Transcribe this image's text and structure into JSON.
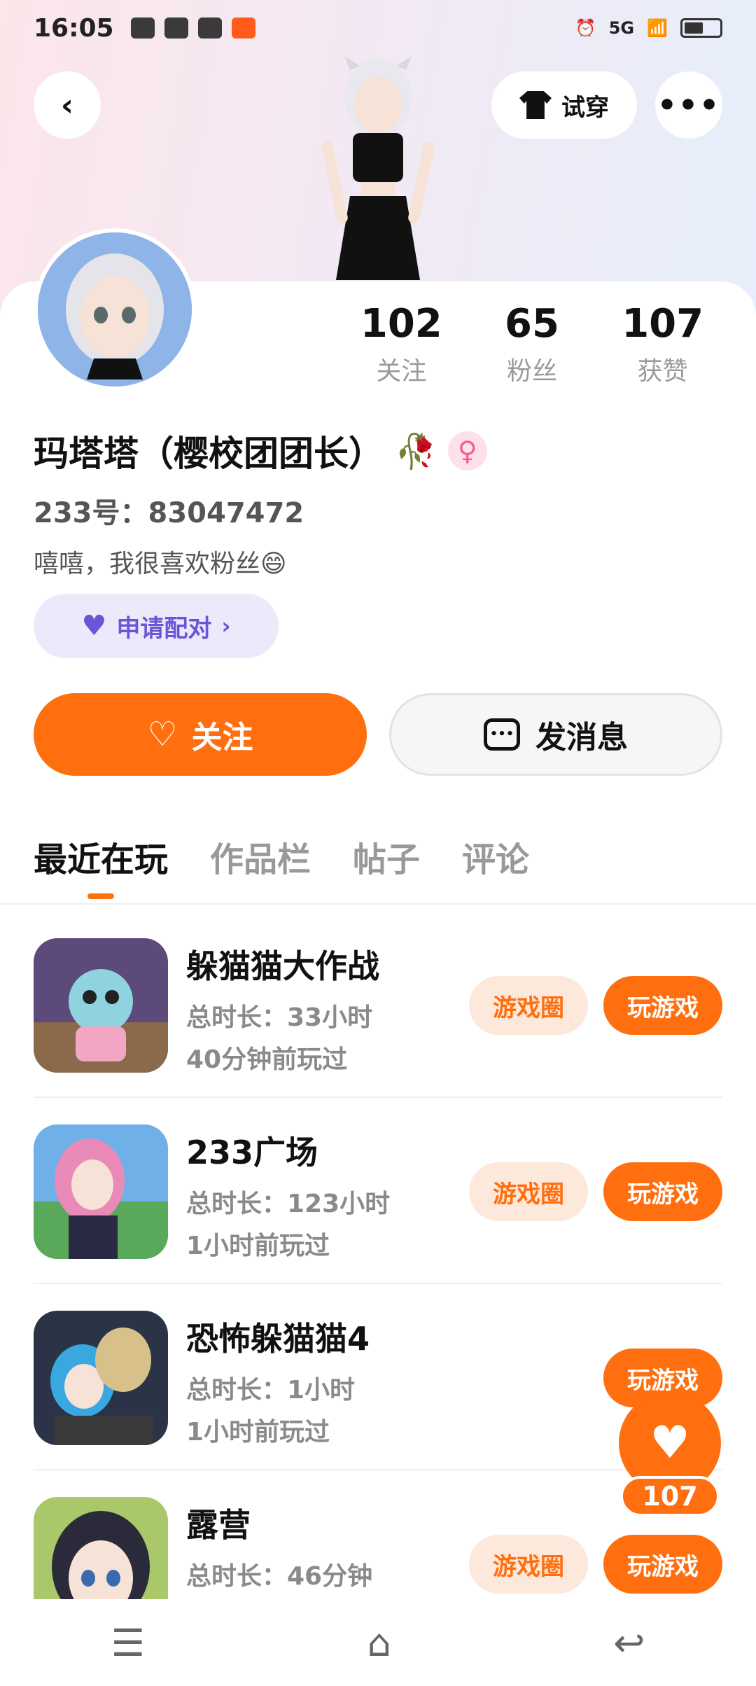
{
  "status_bar": {
    "time": "16:05",
    "network": "5G"
  },
  "header": {
    "try_on_label": "试穿",
    "more_label": "•••"
  },
  "profile": {
    "name": "玛塔塔（樱校团团长）",
    "uid_label": "233号：83047472",
    "bio": "嘻嘻，我很喜欢粉丝😄",
    "stats": [
      {
        "num": "102",
        "label": "关注"
      },
      {
        "num": "65",
        "label": "粉丝"
      },
      {
        "num": "107",
        "label": "获赞"
      }
    ]
  },
  "actions": {
    "pair_label": "申请配对",
    "follow_label": "关注",
    "message_label": "发消息"
  },
  "tabs": [
    "最近在玩",
    "作品栏",
    "帖子",
    "评论"
  ],
  "games": [
    {
      "title": "躲猫猫大作战",
      "total": "总时长：33小时",
      "last": "40分钟前玩过",
      "circle": "游戏圈",
      "play": "玩游戏"
    },
    {
      "title": "233广场",
      "total": "总时长：123小时",
      "last": "1小时前玩过",
      "circle": "游戏圈",
      "play": "玩游戏"
    },
    {
      "title": "恐怖躲猫猫4",
      "total": "总时长：1小时",
      "last": "1小时前玩过",
      "circle": "",
      "play": "玩游戏"
    },
    {
      "title": "露营",
      "total": "总时长：46分钟",
      "last": "",
      "circle": "游戏圈",
      "play": "玩游戏"
    }
  ],
  "like_fab": {
    "count": "107"
  },
  "colors": {
    "accent": "#ff6f0f",
    "purple": "#6a55d6"
  }
}
